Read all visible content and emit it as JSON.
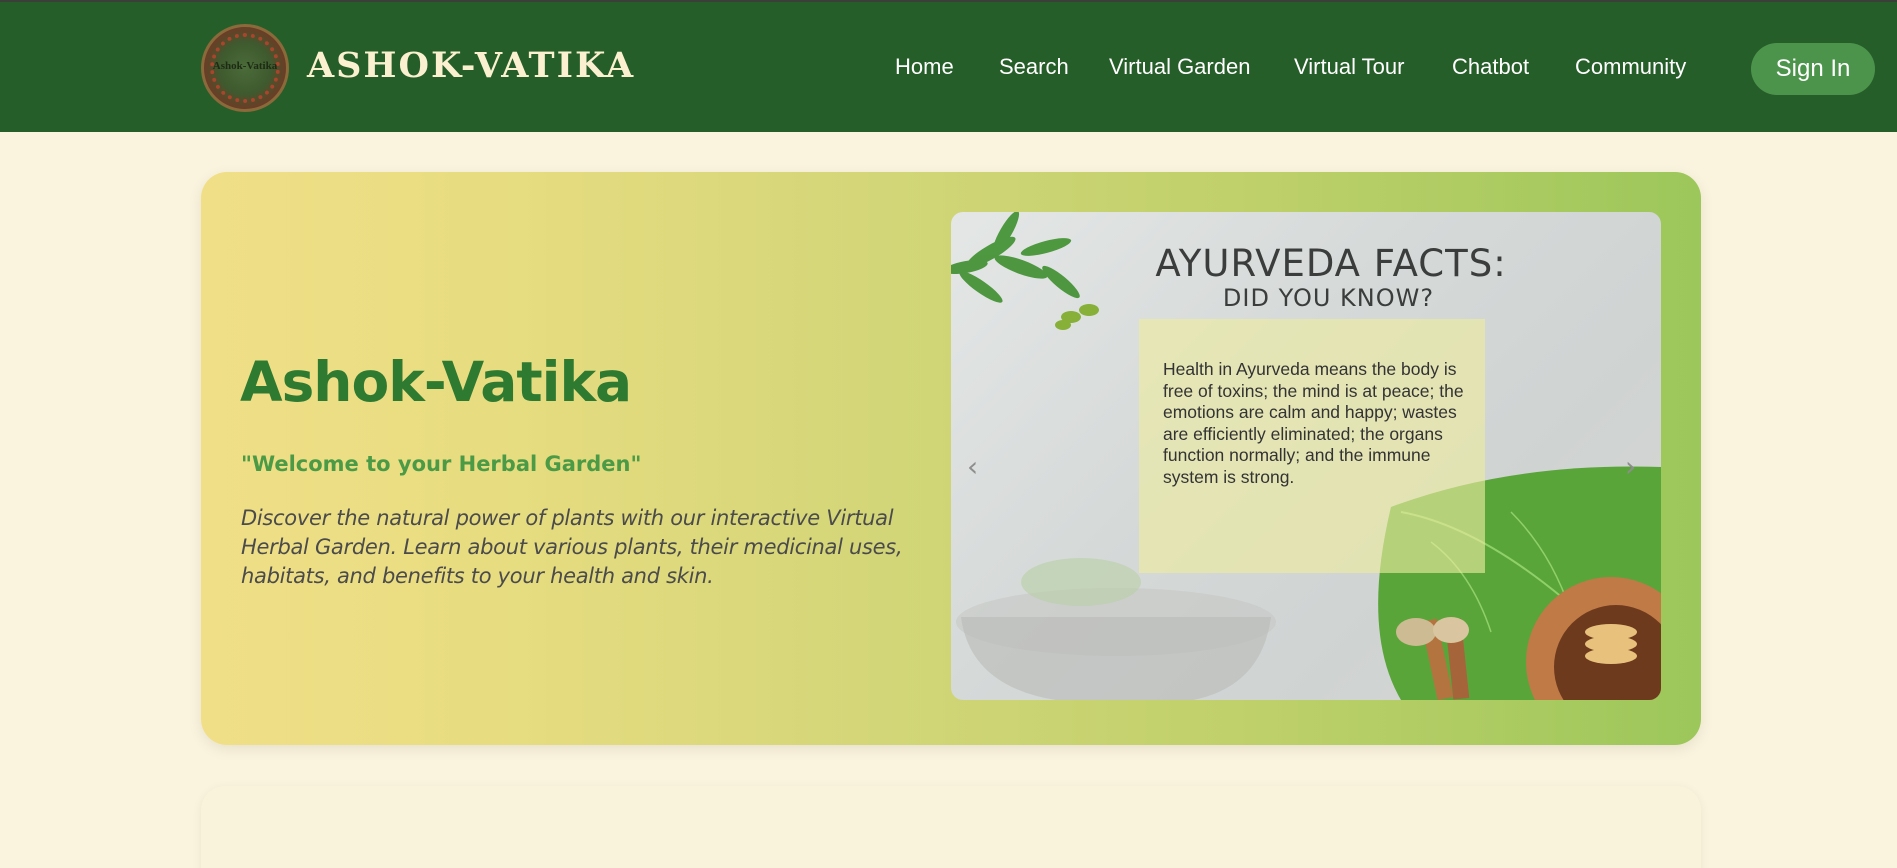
{
  "header": {
    "logo_label": "Ashok-Vatika",
    "brand": "ASHOK-VATIKA",
    "nav": [
      {
        "label": "Home"
      },
      {
        "label": "Search"
      },
      {
        "label": "Virtual Garden"
      },
      {
        "label": "Virtual Tour"
      },
      {
        "label": "Chatbot"
      },
      {
        "label": "Community"
      }
    ],
    "signin_label": "Sign In"
  },
  "hero": {
    "title": "Ashok-Vatika",
    "quote": "\"Welcome to your Herbal Garden\"",
    "description": "Discover the natural power of plants with our interactive Virtual Herbal Garden. Learn about various plants, their medicinal uses, habitats, and benefits to your health and skin."
  },
  "slide": {
    "title": "AYURVEDA FACTS:",
    "subtitle": "DID YOU KNOW?",
    "fact": "Health in Ayurveda means the body is free of toxins; the mind is at peace; the emotions are calm and happy; wastes are efficiently eliminated; the organs function normally; and the immune system is strong.",
    "prev_icon": "‹",
    "next_icon": "›"
  },
  "colors": {
    "header_bg": "#265e29",
    "page_bg": "#faf3dd",
    "accent_green": "#2e7a31",
    "signin_bg": "#4c944c"
  },
  "icons": [
    "chevron-left-icon",
    "chevron-right-icon"
  ]
}
